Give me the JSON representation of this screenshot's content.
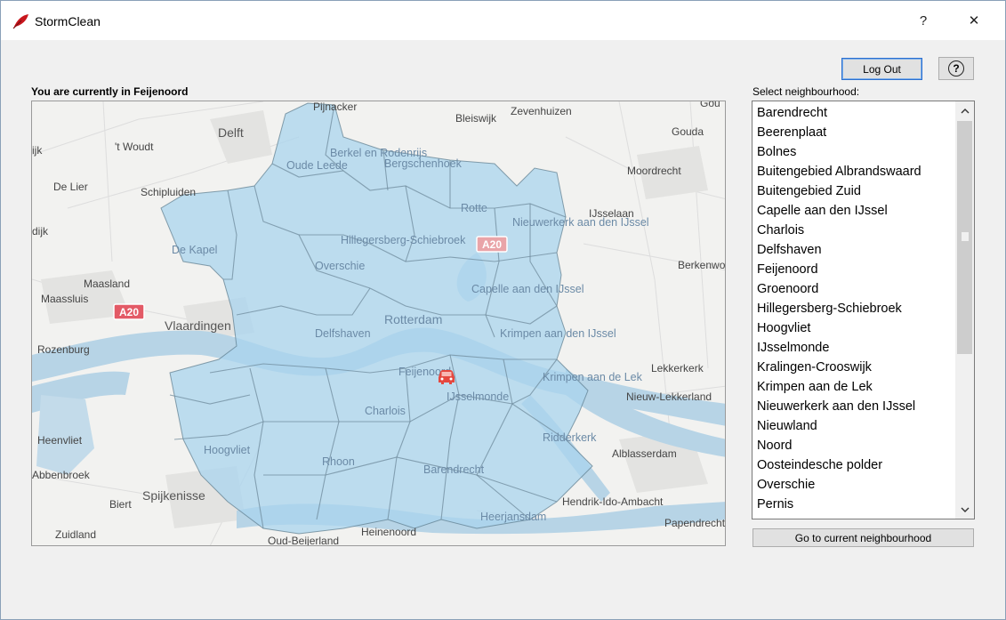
{
  "window": {
    "title": "StormClean",
    "help_glyph": "?",
    "close_glyph": "✕"
  },
  "toolbar": {
    "logout_label": "Log Out",
    "help_label": "?"
  },
  "location": {
    "current_text": "You are currently in Feijenoord"
  },
  "map": {
    "place_labels": [
      "Pijnacker",
      "Bleiswijk",
      "Zevenhuizen",
      "Delft",
      "Gouda",
      "'t Woudt",
      "Moordrecht",
      "De Lier",
      "Schipluiden",
      "IJsselaan",
      "Berkenwo",
      "Maasland",
      "Maassluis",
      "Vlaardingen",
      "Rozenburg",
      "Lekkerkerk",
      "Nieuw-Lekkerland",
      "Heenvliet",
      "Alblasserdam",
      "Abbenbroek",
      "Spijkenisse",
      "Biert",
      "Hendrik-Ido-Ambacht",
      "Papendrecht",
      "Zuidland",
      "Heinenoord",
      "Oud-Beijerland",
      "Gou",
      "dijk",
      "ijk"
    ],
    "neighbourhood_labels": [
      "Berkel en Rodenrijs",
      "Oude Leede",
      "Bergschenhoek",
      "Rotte",
      "Nieuwerkerk aan den IJssel",
      "Hillegersberg-Schiebroek",
      "De Kapel",
      "Overschie",
      "Capelle aan den IJssel",
      "Rotterdam",
      "Delfshaven",
      "Krimpen aan den IJssel",
      "Feijenoord",
      "IJsselmonde",
      "Krimpen aan de Lek",
      "Charlois",
      "Ridderkerk",
      "Hoogvliet",
      "Rhoon",
      "Barendrecht",
      "Heerjansdam"
    ],
    "road_shields": [
      "A20",
      "A20"
    ],
    "current_marker": "car-icon"
  },
  "neighbourhoods": {
    "label": "Select neighbourhood:",
    "items": [
      "Barendrecht",
      "Beerenplaat",
      "Bolnes",
      "Buitengebied Albrandswaard",
      "Buitengebied Zuid",
      "Capelle aan den IJssel",
      "Charlois",
      "Delfshaven",
      "Feijenoord",
      "Groenoord",
      "Hillegersberg-Schiebroek",
      "Hoogvliet",
      "IJsselmonde",
      "Kralingen-Crooswijk",
      "Krimpen aan de Lek",
      "Nieuwerkerk aan den IJssel",
      "Nieuwland",
      "Noord",
      "Oosteindesche polder",
      "Overschie",
      "Pernis"
    ]
  },
  "actions": {
    "goto_label": "Go to current neighbourhood"
  },
  "colors": {
    "accent": "#2c6fcf",
    "region_fill": "#a9d4ee",
    "water": "#b3d2e4",
    "marker": "#e5483f"
  }
}
